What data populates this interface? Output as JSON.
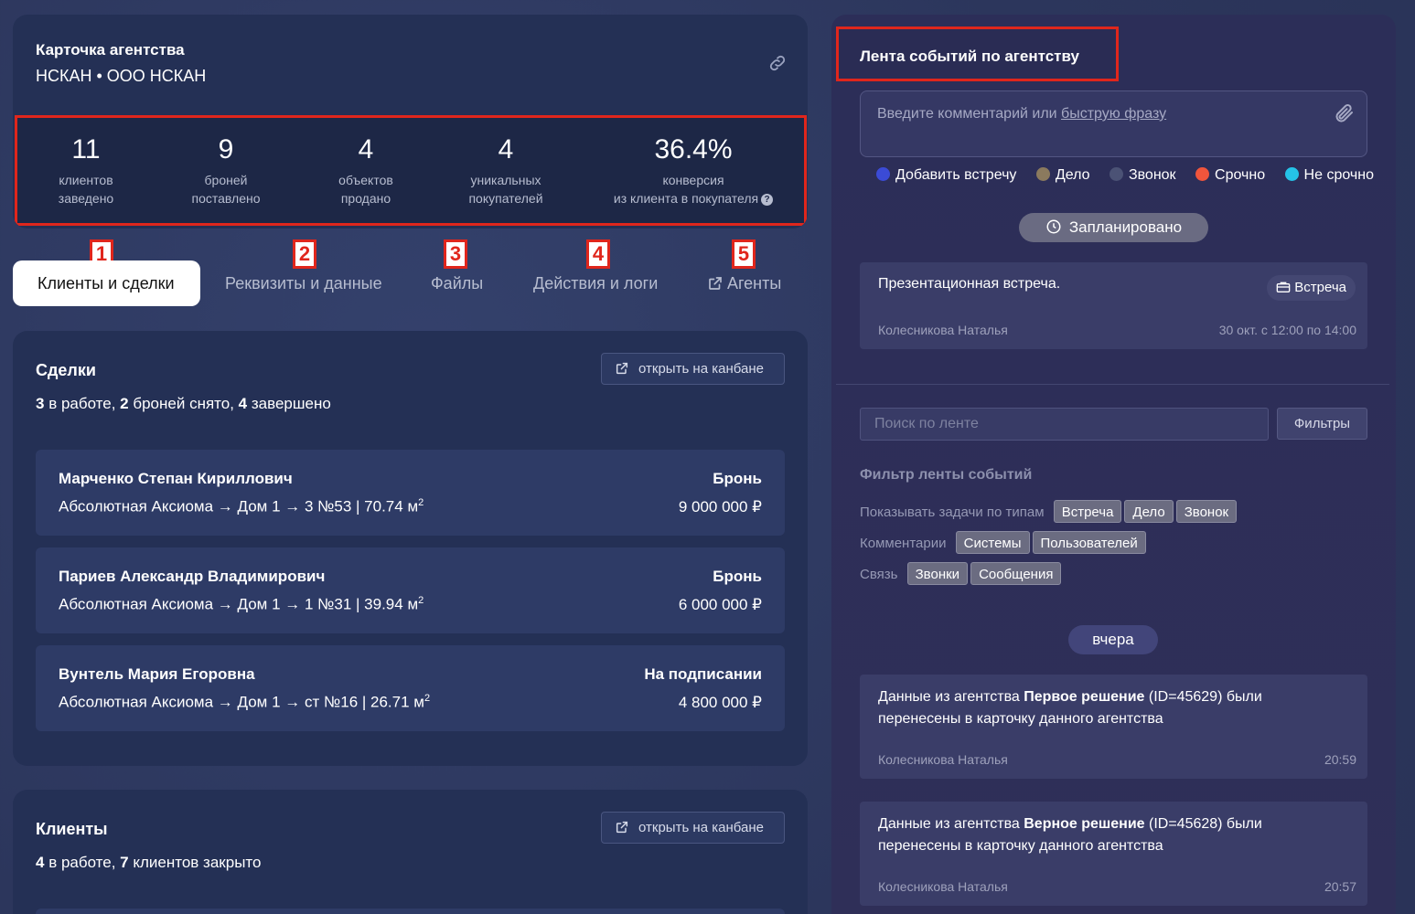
{
  "agency": {
    "title": "Карточка агентства",
    "subtitle": "НСКАН • ООО НСКАН"
  },
  "stats": [
    {
      "value": "11",
      "line1": "клиентов",
      "line2": "заведено"
    },
    {
      "value": "9",
      "line1": "броней",
      "line2": "поставлено"
    },
    {
      "value": "4",
      "line1": "объектов",
      "line2": "продано"
    },
    {
      "value": "4",
      "line1": "уникальных",
      "line2": "покупателей"
    },
    {
      "value": "36.4%",
      "line1": "конверсия",
      "line2": "из клиента в покупателя"
    }
  ],
  "tabs": [
    {
      "label": "Клиенты и сделки",
      "marker": "1"
    },
    {
      "label": "Реквизиты и данные",
      "marker": "2"
    },
    {
      "label": "Файлы",
      "marker": "3"
    },
    {
      "label": "Действия и логи",
      "marker": "4"
    },
    {
      "label": "Агенты",
      "marker": "5"
    }
  ],
  "deals": {
    "title": "Сделки",
    "summary": {
      "n1": "3",
      "t1": " в работе, ",
      "n2": "2",
      "t2": " броней снято, ",
      "n3": "4",
      "t3": " завершено"
    },
    "kanban_label": "открыть на канбане",
    "rows": [
      {
        "name": "Марченко Степан Кириллович",
        "path": "Абсолютная Аксиома → Дом 1 → 3 №53 | 70.74 м",
        "sup": "2",
        "status": "Бронь",
        "price": "9 000 000 ₽"
      },
      {
        "name": "Париев Александр Владимирович",
        "path": "Абсолютная Аксиома → Дом 1 → 1 №31 | 39.94 м",
        "sup": "2",
        "status": "Бронь",
        "price": "6 000 000 ₽"
      },
      {
        "name": "Вунтель Мария Егоровна",
        "path": "Абсолютная Аксиома → Дом 1 → ст №16 | 26.71 м",
        "sup": "2",
        "status": "На подписании",
        "price": "4 800 000 ₽"
      }
    ]
  },
  "clients": {
    "title": "Клиенты",
    "summary": {
      "n1": "4",
      "t1": " в работе, ",
      "n2": "7",
      "t2": " клиентов закрыто"
    },
    "kanban_label": "открыть на канбане"
  },
  "feed": {
    "title": "Лента событий по агентству",
    "comment_placeholder": "Введите комментарий или ",
    "comment_link": "быструю фразу",
    "types": [
      {
        "label": "Добавить встречу",
        "color": "#3b4bd6"
      },
      {
        "label": "Дело",
        "color": "#8b7a5e"
      },
      {
        "label": "Звонок",
        "color": "#4b5275"
      },
      {
        "label": "Срочно",
        "color": "#f0553c"
      },
      {
        "label": "Не срочно",
        "color": "#25c3e8"
      }
    ],
    "scheduled_label": "Запланировано",
    "meeting": {
      "title": "Презентационная встреча.",
      "badge": "Встреча",
      "author": "Колесникова Наталья",
      "time": "30 окт. с 12:00 по 14:00"
    },
    "search_placeholder": "Поиск по ленте",
    "filters_label": "Фильтры",
    "filter_head": "Фильтр ленты событий",
    "filter_rows": [
      {
        "label": "Показывать задачи по типам",
        "chips": [
          "Встреча",
          "Дело",
          "Звонок"
        ]
      },
      {
        "label": "Комментарии",
        "chips": [
          "Системы",
          "Пользователей"
        ]
      },
      {
        "label": "Связь",
        "chips": [
          "Звонки",
          "Сообщения"
        ]
      }
    ],
    "day_label": "вчера",
    "logs": [
      {
        "pre": "Данные из агентства ",
        "bold": "Первое решение",
        "post": " (ID=45629) были перенесены в карточку данного агентства",
        "author": "Колесникова Наталья",
        "time": "20:59"
      },
      {
        "pre": "Данные из агентства ",
        "bold": "Верное решение",
        "post": " (ID=45628) были перенесены в карточку данного агентства",
        "author": "Колесникова Наталья",
        "time": "20:57"
      }
    ]
  },
  "colors": {
    "accent_red": "#e0261c",
    "card_bg": "#243055",
    "feed_bg": "#2d2f57"
  }
}
